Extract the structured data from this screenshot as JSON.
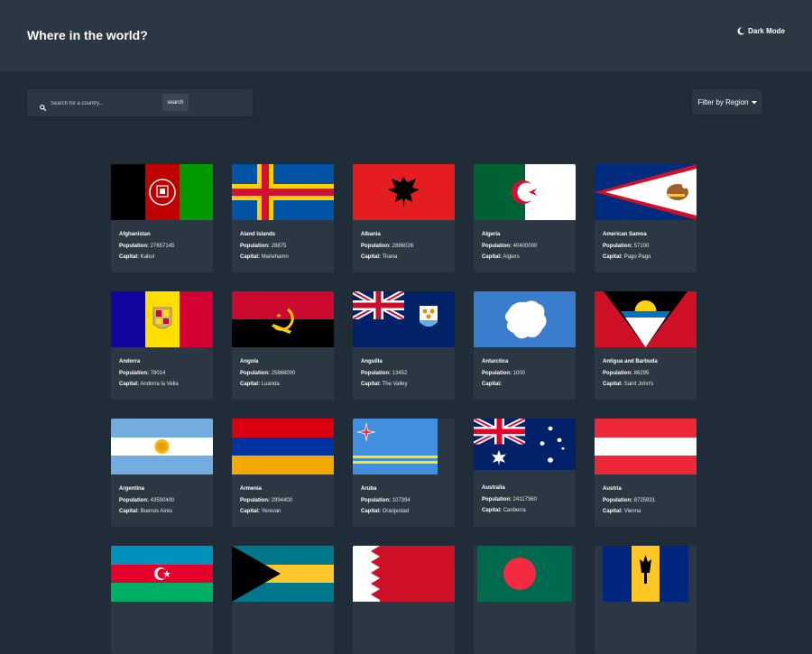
{
  "header": {
    "title": "Where in the world?",
    "theme_toggle_label": "Dark Mode",
    "theme_icon": "moon-icon"
  },
  "search": {
    "placeholder": "Search for a country...",
    "value": "",
    "button_label": "search",
    "icon": "search-icon"
  },
  "filter": {
    "label": "Filter by Region",
    "icon": "caret-down-icon"
  },
  "labels": {
    "population": "Population:",
    "capital": "Capital:"
  },
  "countries": [
    {
      "name": "Afghanistan",
      "population": "27657145",
      "capital": "Kabul"
    },
    {
      "name": "Aland Islands",
      "population": "28875",
      "capital": "Mariehamn"
    },
    {
      "name": "Albania",
      "population": "2886026",
      "capital": "Tirana"
    },
    {
      "name": "Algeria",
      "population": "40400000",
      "capital": "Algiers"
    },
    {
      "name": "American Samoa",
      "population": "57100",
      "capital": "Pago Pago"
    },
    {
      "name": "Andorra",
      "population": "78014",
      "capital": "Andorra la Vella"
    },
    {
      "name": "Angola",
      "population": "25868000",
      "capital": "Luanda"
    },
    {
      "name": "Anguilla",
      "population": "13452",
      "capital": "The Valley"
    },
    {
      "name": "Antarctica",
      "population": "1000",
      "capital": ""
    },
    {
      "name": "Antigua and Barbuda",
      "population": "86295",
      "capital": "Saint John's"
    },
    {
      "name": "Argentina",
      "population": "43590400",
      "capital": "Buenos Aires"
    },
    {
      "name": "Armenia",
      "population": "2994400",
      "capital": "Yerevan"
    },
    {
      "name": "Aruba",
      "population": "107394",
      "capital": "Oranjestad"
    },
    {
      "name": "Australia",
      "population": "24117360",
      "capital": "Canberra"
    },
    {
      "name": "Austria",
      "population": "8725931",
      "capital": "Vienna"
    }
  ],
  "colors": {
    "background": "#202c37",
    "element": "#2b3743",
    "text": "#ffffff"
  }
}
